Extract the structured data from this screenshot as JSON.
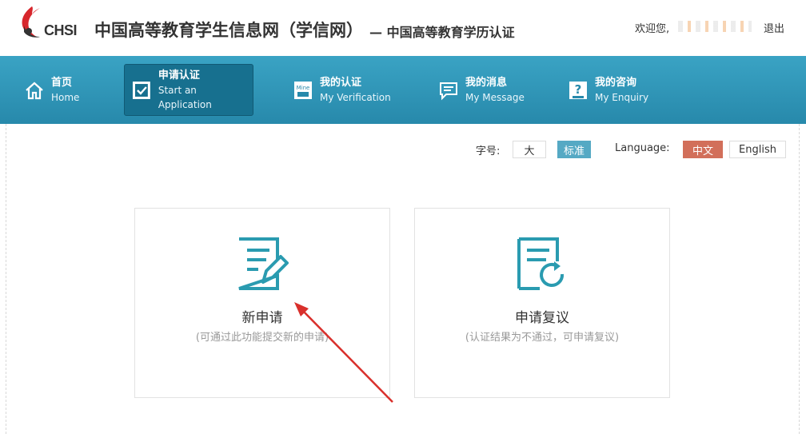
{
  "header": {
    "logo_text": "CHSI",
    "site_title": "中国高等教育学生信息网（学信网）",
    "site_subtitle": "— 中国高等教育学历认证",
    "welcome": "欢迎您,",
    "logout": "退出"
  },
  "nav": {
    "items": [
      {
        "cn": "首页",
        "en": "Home",
        "icon": "home-icon"
      },
      {
        "cn": "申请认证",
        "en": "Start an Application",
        "icon": "checkbox-icon"
      },
      {
        "cn": "我的认证",
        "en": "My Verification",
        "icon": "mine-icon"
      },
      {
        "cn": "我的消息",
        "en": "My Message",
        "icon": "message-icon"
      },
      {
        "cn": "我的咨询",
        "en": "My Enquiry",
        "icon": "question-icon"
      }
    ]
  },
  "toolbar": {
    "font_label": "字号:",
    "font_large": "大",
    "font_standard": "标准",
    "language_label": "Language:",
    "lang_cn": "中文",
    "lang_en": "English"
  },
  "cards": [
    {
      "title": "新申请",
      "desc": "(可通过此功能提交新的申请)",
      "icon": "edit-document-icon"
    },
    {
      "title": "申请复议",
      "desc": "(认证结果为不通过，可申请复议)",
      "icon": "refresh-document-icon"
    }
  ],
  "colors": {
    "nav": "#2f95b8",
    "nav_active": "#17708f",
    "accent_blue": "#55a9c4",
    "accent_red": "#d26f5a",
    "icon_teal": "#2a9bb0",
    "arrow": "#d9302c"
  }
}
